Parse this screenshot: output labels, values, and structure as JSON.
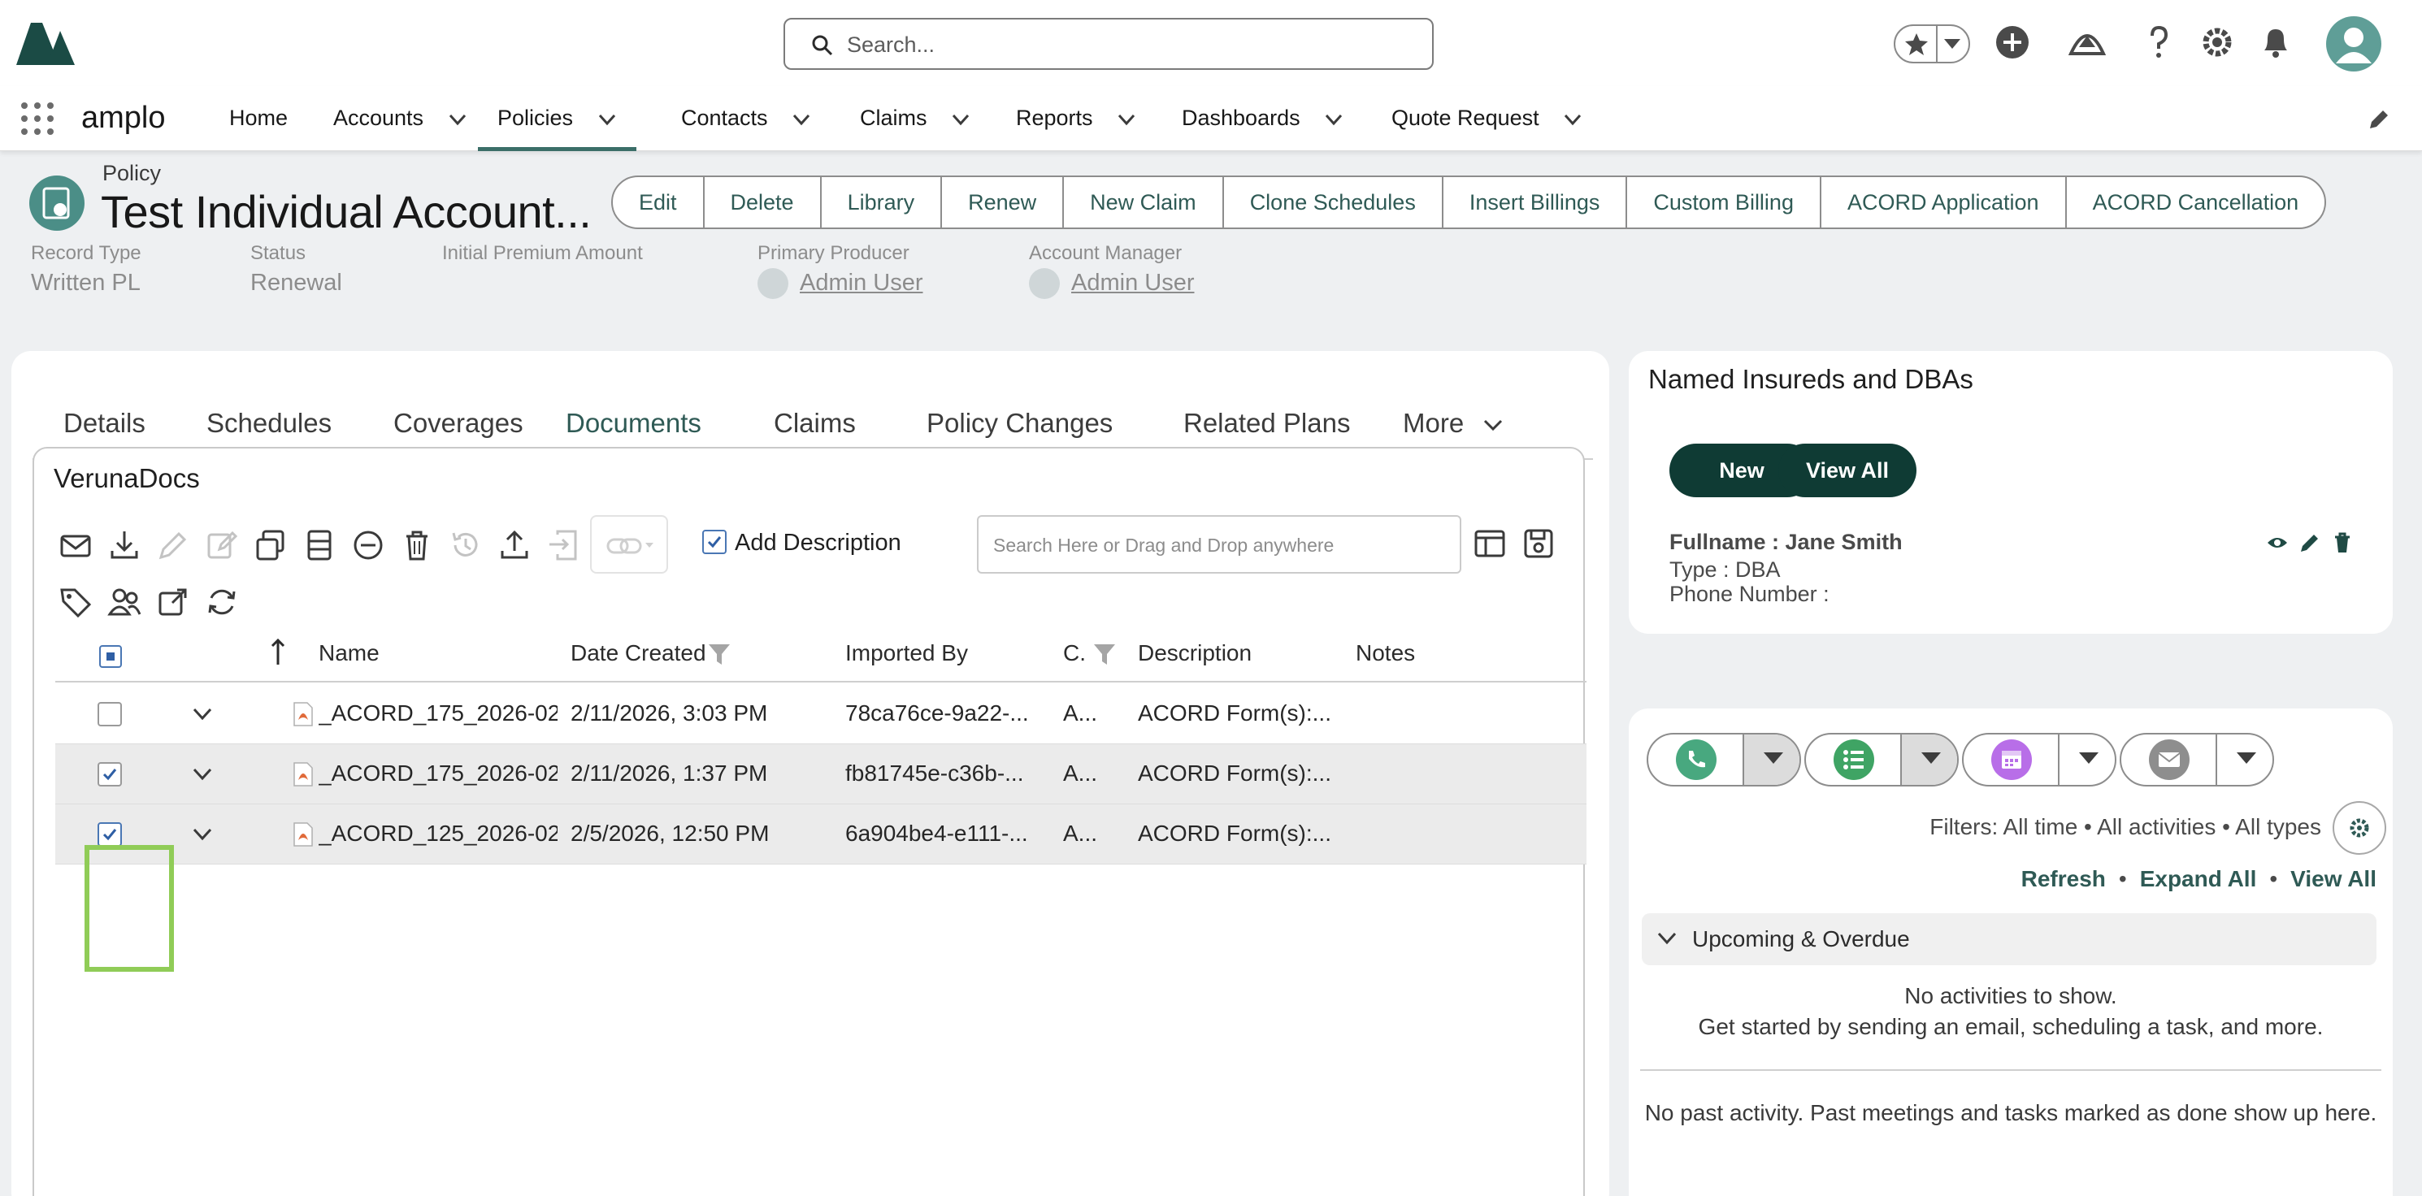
{
  "header": {
    "search_placeholder": "Search...",
    "icons": [
      "favorites-star-icon",
      "chevron-down-icon",
      "add-icon",
      "trailhead-icon",
      "help-icon",
      "setup-gear-icon",
      "notifications-bell-icon",
      "user-avatar"
    ]
  },
  "nav": {
    "app_name": "amplo",
    "items": [
      {
        "label": "Home"
      },
      {
        "label": "Accounts"
      },
      {
        "label": "Policies"
      },
      {
        "label": "Contacts"
      },
      {
        "label": "Claims"
      },
      {
        "label": "Reports"
      },
      {
        "label": "Dashboards"
      },
      {
        "label": "Quote Request"
      }
    ]
  },
  "record": {
    "object_label": "Policy",
    "title": "Test Individual Account...",
    "actions": [
      "Edit",
      "Delete",
      "Library",
      "Renew",
      "New Claim",
      "Clone Schedules",
      "Insert Billings",
      "Custom Billing",
      "ACORD Application",
      "ACORD Cancellation"
    ],
    "fields": {
      "record_type_label": "Record Type",
      "record_type_value": "Written PL",
      "status_label": "Status",
      "status_value": "Renewal",
      "premium_label": "Initial Premium Amount",
      "producer_label": "Primary Producer",
      "producer_value": "Admin User",
      "manager_label": "Account Manager",
      "manager_value": "Admin User"
    }
  },
  "tabs": [
    "Details",
    "Schedules",
    "Coverages",
    "Documents",
    "Claims",
    "Policy Changes",
    "Related Plans",
    "More"
  ],
  "active_tab": "Documents",
  "docs": {
    "title": "VerunaDocs",
    "add_description_label": "Add Description",
    "search_placeholder": "Search Here or Drag and Drop anywhere",
    "columns": [
      "Name",
      "Date Created",
      "Imported By",
      "C.",
      "Description",
      "Notes"
    ],
    "rows": [
      {
        "name": "_ACORD_175_2026-02-",
        "date": "2/11/2026, 3:03 PM",
        "imported_by": "78ca76ce-9a22-...",
        "c": "A...",
        "description": "ACORD Form(s):...",
        "notes": "",
        "checked": false
      },
      {
        "name": "_ACORD_175_2026-02-",
        "date": "2/11/2026, 1:37 PM",
        "imported_by": "fb81745e-c36b-...",
        "c": "A...",
        "description": "ACORD Form(s):...",
        "notes": "",
        "checked": true
      },
      {
        "name": "_ACORD_125_2026-02-",
        "date": "2/5/2026, 12:50 PM",
        "imported_by": "6a904be4-e111-...",
        "c": "A...",
        "description": "ACORD Form(s):...",
        "notes": "",
        "checked": true
      }
    ]
  },
  "named_insureds": {
    "title": "Named Insureds and DBAs",
    "new_label": "New",
    "view_all_label": "View All",
    "fullname": "Fullname : Jane Smith",
    "type": "Type : DBA",
    "phone": "Phone Number :"
  },
  "activity": {
    "filters": "Filters: All time • All activities • All types",
    "refresh": "Refresh",
    "expand_all": "Expand All",
    "view_all": "View All",
    "upcoming_label": "Upcoming & Overdue",
    "no_activities": "No activities to show.",
    "get_started": "Get started by sending an email, scheduling a task, and more.",
    "no_past": "No past activity. Past meetings and tasks marked as done show up here."
  },
  "colors": {
    "brand_dark": "#0f3b34",
    "accent_teal": "#3b6e68",
    "link_teal": "#2f5a55",
    "highlight_green": "#90cc57",
    "call_green": "#48a87f",
    "task_green": "#3fa464",
    "event_purple": "#b86ee8",
    "email_gray": "#8e8e8e"
  }
}
